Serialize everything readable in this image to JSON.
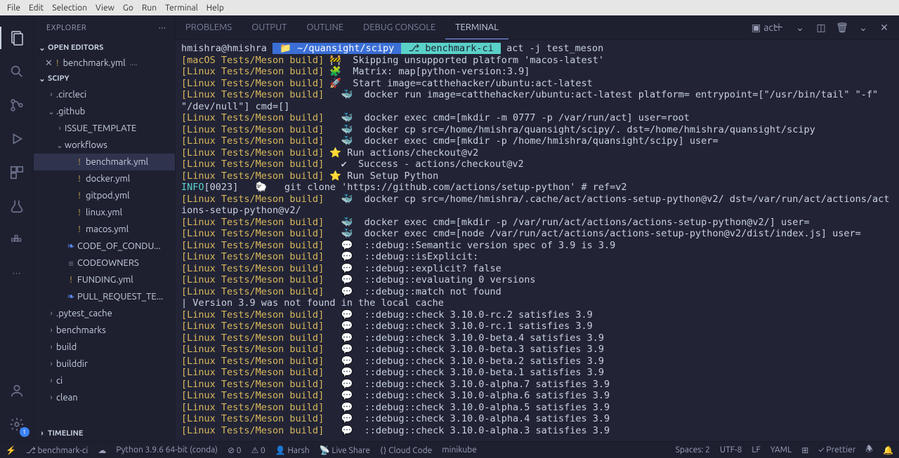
{
  "menubar": [
    "File",
    "Edit",
    "Selection",
    "View",
    "Go",
    "Run",
    "Terminal",
    "Help"
  ],
  "sidebar": {
    "title": "EXPLORER",
    "openEditors": {
      "title": "OPEN EDITORS",
      "items": [
        {
          "name": "benchmark.yml",
          "pathSuffix": "...."
        }
      ]
    },
    "project": {
      "title": "SCIPY",
      "tree": [
        {
          "type": "folder",
          "name": ".circleci",
          "depth": 1,
          "expanded": false
        },
        {
          "type": "folder",
          "name": ".github",
          "depth": 1,
          "expanded": true
        },
        {
          "type": "folder",
          "name": "ISSUE_TEMPLATE",
          "depth": 2,
          "expanded": false
        },
        {
          "type": "folder",
          "name": "workflows",
          "depth": 2,
          "expanded": true
        },
        {
          "type": "file",
          "name": "benchmark.yml",
          "depth": 3,
          "icon": "!",
          "iconCls": "mod",
          "selected": true
        },
        {
          "type": "file",
          "name": "docker.yml",
          "depth": 3,
          "icon": "!",
          "iconCls": "mod"
        },
        {
          "type": "file",
          "name": "gitpod.yml",
          "depth": 3,
          "icon": "!",
          "iconCls": "mod"
        },
        {
          "type": "file",
          "name": "linux.yml",
          "depth": 3,
          "icon": "!",
          "iconCls": "mod"
        },
        {
          "type": "file",
          "name": "macos.yml",
          "depth": 3,
          "icon": "!",
          "iconCls": "mod"
        },
        {
          "type": "file",
          "name": "CODE_OF_CONDU...",
          "depth": 2,
          "icon": "❧",
          "iconCls": "blue"
        },
        {
          "type": "file",
          "name": "CODEOWNERS",
          "depth": 2,
          "icon": "≡",
          "iconCls": ""
        },
        {
          "type": "file",
          "name": "FUNDING.yml",
          "depth": 2,
          "icon": "!",
          "iconCls": "mod"
        },
        {
          "type": "file",
          "name": "PULL_REQUEST_TE...",
          "depth": 2,
          "icon": "❧",
          "iconCls": "blue"
        },
        {
          "type": "folder",
          "name": ".pytest_cache",
          "depth": 1,
          "expanded": false
        },
        {
          "type": "folder",
          "name": "benchmarks",
          "depth": 1,
          "expanded": false
        },
        {
          "type": "folder",
          "name": "build",
          "depth": 1,
          "expanded": false
        },
        {
          "type": "folder",
          "name": "builddir",
          "depth": 1,
          "expanded": false
        },
        {
          "type": "folder",
          "name": "ci",
          "depth": 1,
          "expanded": false
        },
        {
          "type": "folder",
          "name": "clean",
          "depth": 1,
          "expanded": false
        }
      ]
    },
    "timeline": "TIMELINE"
  },
  "panel": {
    "tabs": [
      "PROBLEMS",
      "OUTPUT",
      "OUTLINE",
      "DEBUG CONSOLE",
      "TERMINAL"
    ],
    "activeTab": 4,
    "rightLabel": "act"
  },
  "terminal": {
    "prompt": {
      "user": "hmishra@hmishra",
      "path": "~/quansight/scipy",
      "branch": "benchmark-ci",
      "cmd": "act -j test_meson"
    },
    "lines": [
      {
        "tag": "[macOS Tests/Meson build]",
        "sym": "🚧",
        "text": "  Skipping unsupported platform 'macos-latest'"
      },
      {
        "tag": "[Linux Tests/Meson build]",
        "sym": "🧩",
        "text": "  Matrix: map[python-version:3.9]"
      },
      {
        "tag": "[Linux Tests/Meson build]",
        "sym": "🚀",
        "text": "  Start image=catthehacker/ubuntu:act-latest"
      },
      {
        "tag": "[Linux Tests/Meson build]",
        "sym": "  🐳",
        "text": "  docker run image=catthehacker/ubuntu:act-latest platform= entrypoint=[\"/usr/bin/tail\" \"-f\" \"/dev/null\"] cmd=[]"
      },
      {
        "tag": "[Linux Tests/Meson build]",
        "sym": "  🐳",
        "text": "  docker exec cmd=[mkdir -m 0777 -p /var/run/act] user=root"
      },
      {
        "tag": "[Linux Tests/Meson build]",
        "sym": "  🐳",
        "text": "  docker cp src=/home/hmishra/quansight/scipy/. dst=/home/hmishra/quansight/scipy"
      },
      {
        "tag": "[Linux Tests/Meson build]",
        "sym": "  🐳",
        "text": "  docker exec cmd=[mkdir -p /home/hmishra/quansight/scipy] user="
      },
      {
        "tag": "[Linux Tests/Meson build]",
        "sym": "⭐",
        "text": " Run actions/checkout@v2"
      },
      {
        "tag": "[Linux Tests/Meson build]",
        "sym": "  ✔",
        "text": "  Success - actions/checkout@v2"
      },
      {
        "tag": "[Linux Tests/Meson build]",
        "sym": "⭐",
        "text": " Run Setup Python"
      },
      {
        "tag": "INFO",
        "sym": "",
        "text": "[0023]   🐑   git clone 'https://github.com/actions/setup-python' # ref=v2",
        "info": true
      },
      {
        "tag": "[Linux Tests/Meson build]",
        "sym": "  🐳",
        "text": "  docker cp src=/home/hmishra/.cache/act/actions-setup-python@v2/ dst=/var/run/act/actions/actions-setup-python@v2/"
      },
      {
        "tag": "[Linux Tests/Meson build]",
        "sym": "  🐳",
        "text": "  docker exec cmd=[mkdir -p /var/run/act/actions/actions-setup-python@v2/] user="
      },
      {
        "tag": "[Linux Tests/Meson build]",
        "sym": "  🐳",
        "text": "  docker exec cmd=[node /var/run/act/actions/actions-setup-python@v2/dist/index.js] user="
      },
      {
        "tag": "[Linux Tests/Meson build]",
        "sym": "  💬",
        "text": "  ::debug::Semantic version spec of 3.9 is 3.9"
      },
      {
        "tag": "[Linux Tests/Meson build]",
        "sym": "  💬",
        "text": "  ::debug::isExplicit: "
      },
      {
        "tag": "[Linux Tests/Meson build]",
        "sym": "  💬",
        "text": "  ::debug::explicit? false"
      },
      {
        "tag": "[Linux Tests/Meson build]",
        "sym": "  💬",
        "text": "  ::debug::evaluating 0 versions"
      },
      {
        "tag": "[Linux Tests/Meson build]",
        "sym": "  💬",
        "text": "  ::debug::match not found"
      },
      {
        "tag": "",
        "sym": "",
        "text": "| Version 3.9 was not found in the local cache",
        "plain": true
      },
      {
        "tag": "[Linux Tests/Meson build]",
        "sym": "  💬",
        "text": "  ::debug::check 3.10.0-rc.2 satisfies 3.9"
      },
      {
        "tag": "[Linux Tests/Meson build]",
        "sym": "  💬",
        "text": "  ::debug::check 3.10.0-rc.1 satisfies 3.9"
      },
      {
        "tag": "[Linux Tests/Meson build]",
        "sym": "  💬",
        "text": "  ::debug::check 3.10.0-beta.4 satisfies 3.9"
      },
      {
        "tag": "[Linux Tests/Meson build]",
        "sym": "  💬",
        "text": "  ::debug::check 3.10.0-beta.3 satisfies 3.9"
      },
      {
        "tag": "[Linux Tests/Meson build]",
        "sym": "  💬",
        "text": "  ::debug::check 3.10.0-beta.2 satisfies 3.9"
      },
      {
        "tag": "[Linux Tests/Meson build]",
        "sym": "  💬",
        "text": "  ::debug::check 3.10.0-beta.1 satisfies 3.9"
      },
      {
        "tag": "[Linux Tests/Meson build]",
        "sym": "  💬",
        "text": "  ::debug::check 3.10.0-alpha.7 satisfies 3.9"
      },
      {
        "tag": "[Linux Tests/Meson build]",
        "sym": "  💬",
        "text": "  ::debug::check 3.10.0-alpha.6 satisfies 3.9"
      },
      {
        "tag": "[Linux Tests/Meson build]",
        "sym": "  💬",
        "text": "  ::debug::check 3.10.0-alpha.5 satisfies 3.9"
      },
      {
        "tag": "[Linux Tests/Meson build]",
        "sym": "  💬",
        "text": "  ::debug::check 3.10.0-alpha.4 satisfies 3.9"
      },
      {
        "tag": "[Linux Tests/Meson build]",
        "sym": "  💬",
        "text": "  ::debug::check 3.10.0-alpha.3 satisfies 3.9"
      }
    ]
  },
  "statusbar": {
    "left": [
      {
        "icon": "⎇",
        "text": "benchmark-ci",
        "name": "git-branch"
      },
      {
        "icon": "☁",
        "text": "",
        "name": "sync"
      },
      {
        "icon": "",
        "text": "Python 3.9.6 64-bit (conda)",
        "name": "python-interpreter"
      },
      {
        "icon": "⊘",
        "text": "0",
        "name": "errors"
      },
      {
        "icon": "⚠",
        "text": "0",
        "name": "warnings"
      },
      {
        "icon": "👤",
        "text": "Harsh",
        "name": "account"
      },
      {
        "icon": "📡",
        "text": "Live Share",
        "name": "liveshare"
      },
      {
        "icon": "⟨⟩",
        "text": "Cloud Code",
        "name": "cloud-code"
      },
      {
        "icon": "",
        "text": "minikube",
        "name": "minikube"
      }
    ],
    "right": [
      {
        "text": "Spaces: 2",
        "name": "indent"
      },
      {
        "text": "UTF-8",
        "name": "encoding"
      },
      {
        "text": "LF",
        "name": "eol"
      },
      {
        "text": "YAML",
        "name": "language"
      },
      {
        "text": "⊞",
        "name": "layout"
      },
      {
        "text": "✓ Prettier",
        "name": "prettier"
      },
      {
        "text": "🕭",
        "name": "feedback"
      },
      {
        "text": "🔔",
        "name": "notifications"
      }
    ]
  },
  "activitybar": {
    "badge": "1"
  }
}
